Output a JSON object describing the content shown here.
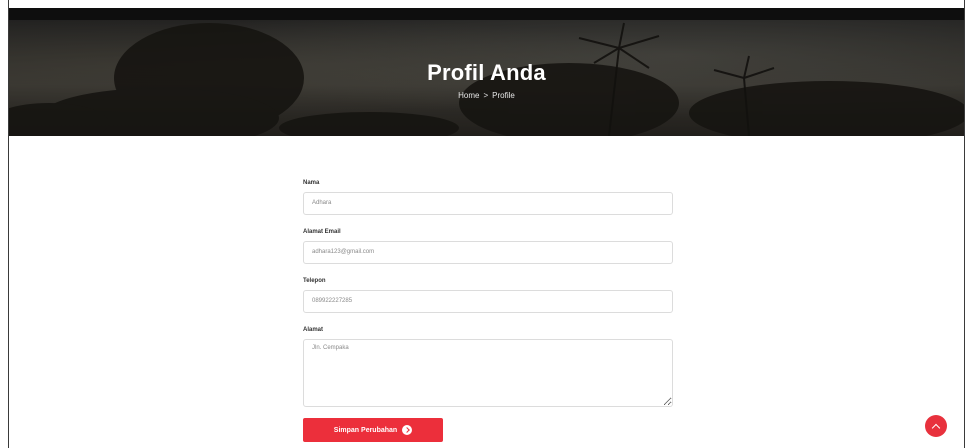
{
  "hero": {
    "title": "Profil Anda",
    "breadcrumb": {
      "home": "Home",
      "separator": ">",
      "current": "Profile"
    }
  },
  "form": {
    "fields": [
      {
        "label": "Nama",
        "value": "Adhara"
      },
      {
        "label": "Alamat Email",
        "value": "adhara123@gmail.com"
      },
      {
        "label": "Telepon",
        "value": "089922227285"
      }
    ],
    "address": {
      "label": "Alamat",
      "value": "Jln. Cempaka"
    },
    "submit_label": "Simpan Perubahan"
  },
  "colors": {
    "accent": "#ec2f3b",
    "hero_bg": "#2f2c27"
  },
  "icons": {
    "submit": "arrow-circle-icon",
    "scroll_top": "chevron-up-icon"
  }
}
